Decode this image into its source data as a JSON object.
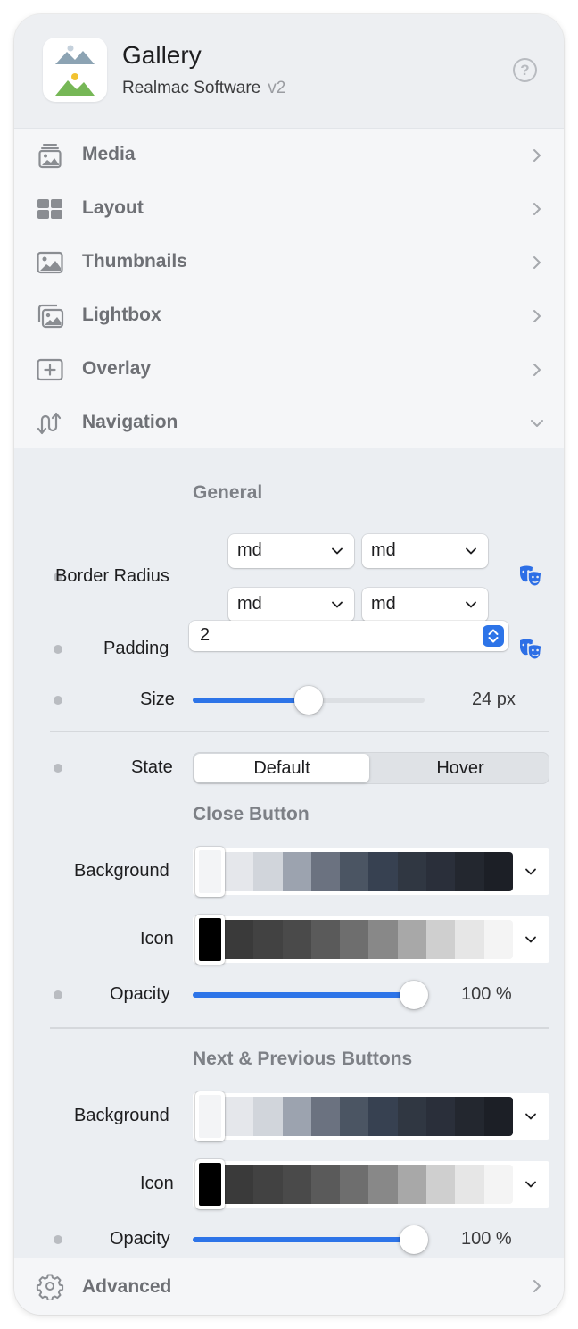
{
  "header": {
    "title": "Gallery",
    "vendor": "Realmac Software",
    "version": "v2"
  },
  "nav": {
    "items": [
      {
        "label": "Media",
        "icon": "media-stack-icon"
      },
      {
        "label": "Layout",
        "icon": "grid-layout-icon"
      },
      {
        "label": "Thumbnails",
        "icon": "image-icon"
      },
      {
        "label": "Lightbox",
        "icon": "photo-stack-icon"
      },
      {
        "label": "Overlay",
        "icon": "plus-square-icon"
      },
      {
        "label": "Navigation",
        "icon": "swap-arrows-icon",
        "expanded": true
      }
    ]
  },
  "navigation": {
    "general_heading": "General",
    "border_radius": {
      "label": "Border Radius",
      "values": [
        "md",
        "md",
        "md",
        "md"
      ]
    },
    "padding": {
      "label": "Padding",
      "value": "2"
    },
    "size": {
      "label": "Size",
      "value": 24,
      "min": 0,
      "max": 48,
      "display": "24 px"
    },
    "state": {
      "label": "State",
      "options": [
        "Default",
        "Hover"
      ],
      "selected": "Default"
    },
    "close_button": {
      "heading": "Close Button",
      "background": {
        "label": "Background",
        "selected": "#f3f4f6",
        "swatches": [
          "#e5e7eb",
          "#d1d5db",
          "#9ca3af",
          "#6b7280",
          "#4b5563",
          "#374151",
          "#303742",
          "#2a2f3a",
          "#23272f",
          "#1c1f26"
        ]
      },
      "icon": {
        "label": "Icon",
        "selected": "#000000",
        "swatches": [
          "#3a3a3a",
          "#424242",
          "#4a4a4a",
          "#5a5a5a",
          "#6e6e6e",
          "#888888",
          "#a8a8a8",
          "#cfcfcf",
          "#e6e6e6",
          "#f4f4f4"
        ]
      },
      "opacity": {
        "label": "Opacity",
        "value": 100,
        "display": "100 %"
      }
    },
    "nav_buttons": {
      "heading": "Next & Previous Buttons",
      "background": {
        "label": "Background",
        "selected": "#f3f4f6",
        "swatches": [
          "#e5e7eb",
          "#d1d5db",
          "#9ca3af",
          "#6b7280",
          "#4b5563",
          "#374151",
          "#303742",
          "#2a2f3a",
          "#23272f",
          "#1c1f26"
        ]
      },
      "icon": {
        "label": "Icon",
        "selected": "#000000",
        "swatches": [
          "#3a3a3a",
          "#424242",
          "#4a4a4a",
          "#5a5a5a",
          "#6e6e6e",
          "#888888",
          "#a8a8a8",
          "#cfcfcf",
          "#e6e6e6",
          "#f4f4f4"
        ]
      },
      "opacity": {
        "label": "Opacity",
        "value": 100,
        "display": "100 %"
      }
    }
  },
  "footer": {
    "label": "Advanced",
    "icon": "gear-icon"
  },
  "colors": {
    "accent": "#2d74e8",
    "panel": "#ebeef2",
    "nav_bg": "#f5f6f8",
    "label_gray": "#6e7075"
  }
}
